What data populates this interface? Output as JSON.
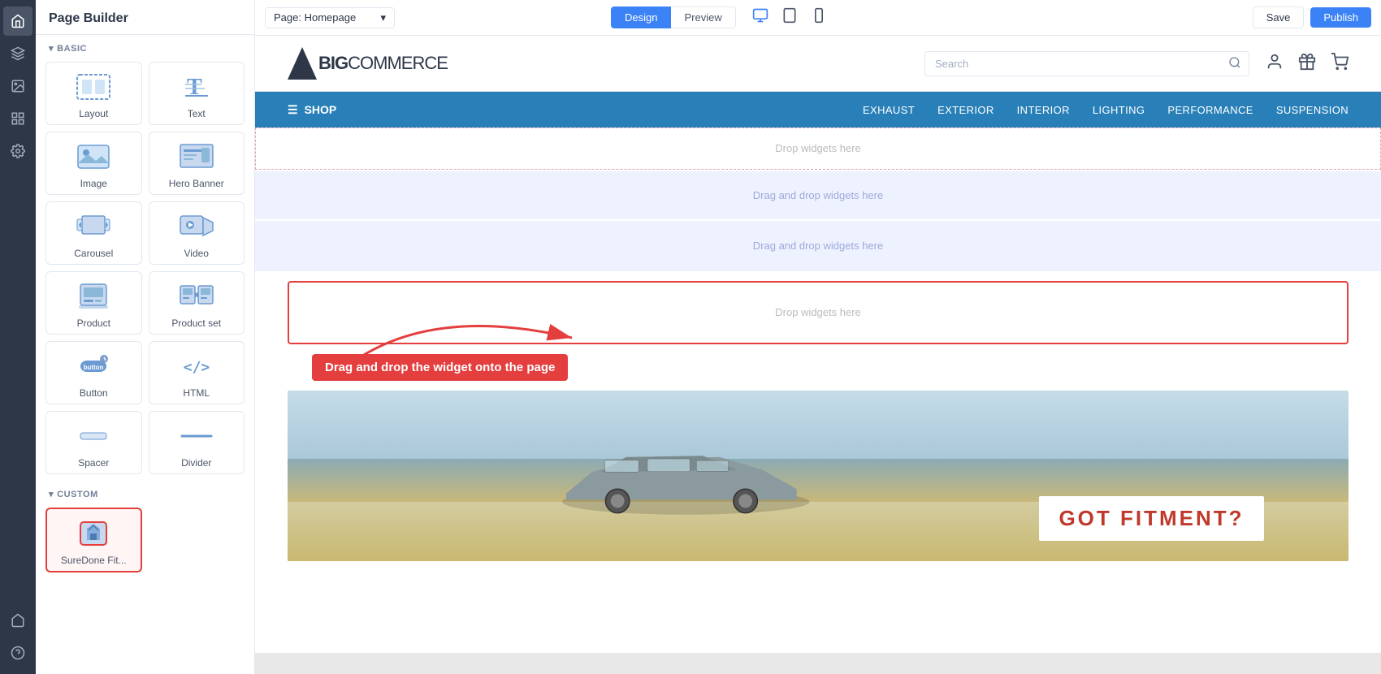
{
  "topbar": {
    "page_label": "Page: Homepage",
    "design_btn": "Design",
    "preview_btn": "Preview",
    "save_btn": "Save",
    "publish_btn": "Publish"
  },
  "widget_panel": {
    "title": "Page Builder",
    "basic_label": "BASIC",
    "custom_label": "CUSTOM",
    "widgets": [
      {
        "id": "layout",
        "label": "Layout",
        "type": "layout"
      },
      {
        "id": "text",
        "label": "Text",
        "type": "text"
      },
      {
        "id": "image",
        "label": "Image",
        "type": "image"
      },
      {
        "id": "hero-banner",
        "label": "Hero Banner",
        "type": "hero"
      },
      {
        "id": "carousel",
        "label": "Carousel",
        "type": "carousel"
      },
      {
        "id": "video",
        "label": "Video",
        "type": "video"
      },
      {
        "id": "product",
        "label": "Product",
        "type": "product"
      },
      {
        "id": "product-set",
        "label": "Product set",
        "type": "productset"
      },
      {
        "id": "button",
        "label": "Button",
        "type": "button"
      },
      {
        "id": "html",
        "label": "HTML",
        "type": "html"
      },
      {
        "id": "spacer",
        "label": "Spacer",
        "type": "spacer"
      },
      {
        "id": "divider",
        "label": "Divider",
        "type": "divider"
      }
    ],
    "custom_widgets": [
      {
        "id": "suredone",
        "label": "SureDone Fit...",
        "type": "suredone",
        "highlighted": true
      }
    ]
  },
  "store": {
    "logo_text_bold": "BIG",
    "logo_text_regular": "COMMERCE",
    "search_placeholder": "Search",
    "nav_shop": "SHOP",
    "nav_links": [
      "EXHAUST",
      "EXTERIOR",
      "INTERIOR",
      "LIGHTING",
      "PERFORMANCE",
      "SUSPENSION"
    ]
  },
  "canvas": {
    "drop_zone_1": "Drop widgets here",
    "drop_zone_2": "Drag and drop widgets here",
    "drop_zone_3": "Drag and drop widgets here",
    "drop_zone_active": "Drop widgets here",
    "annotation": "Drag and drop the widget onto the page",
    "hero_text": "GOT FITMENT?"
  },
  "icons": {
    "desktop": "🖥",
    "tablet": "▭",
    "mobile": "📱",
    "search": "🔍",
    "user": "👤",
    "gift": "🎁",
    "cart": "🛒",
    "menu": "☰",
    "caret_down": "▾",
    "caret_right": "▶"
  },
  "colors": {
    "nav_bg": "#2980b9",
    "accent_red": "#e53e3e",
    "highlight_blue": "#3b82f6"
  }
}
